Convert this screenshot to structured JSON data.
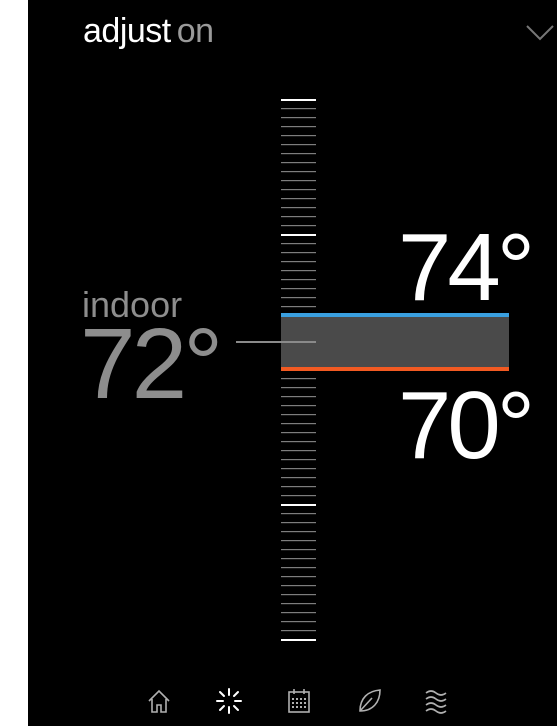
{
  "header": {
    "title": "adjust",
    "mode": "on"
  },
  "indoor": {
    "label": "indoor",
    "temp": "72°"
  },
  "setpoints": {
    "cool": "74°",
    "heat": "70°"
  },
  "colors": {
    "cool": "#3aa0e0",
    "heat": "#f25a22",
    "band": "#4a4a4a"
  },
  "icons": [
    "chevron-down-icon",
    "home-icon",
    "fan-icon",
    "calendar-icon",
    "leaf-icon",
    "humidity-icon"
  ],
  "nav": {
    "items": [
      {
        "name": "home",
        "icon": "home-icon"
      },
      {
        "name": "fan",
        "icon": "fan-icon"
      },
      {
        "name": "schedule",
        "icon": "calendar-icon"
      },
      {
        "name": "eco",
        "icon": "leaf-icon"
      },
      {
        "name": "humidity",
        "icon": "humidity-icon"
      }
    ]
  }
}
